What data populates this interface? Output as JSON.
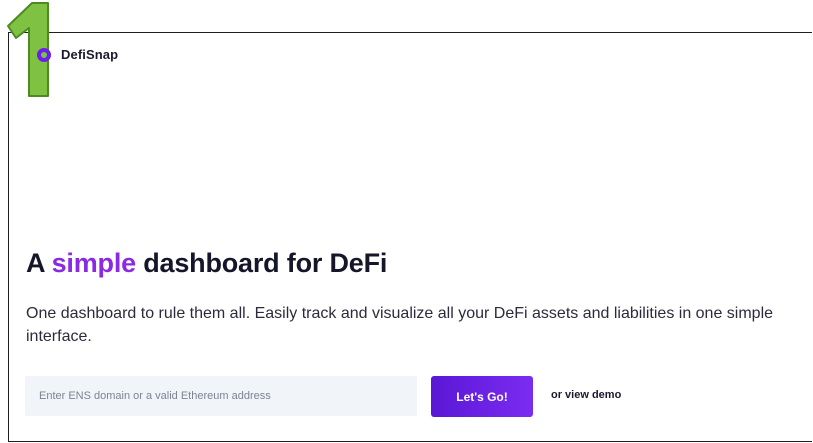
{
  "annotation": {
    "step_number": "1",
    "color": "#7fc241"
  },
  "brand": {
    "name": "DefiSnap",
    "accent_color": "#6b1ef0"
  },
  "hero": {
    "title_prefix": "A ",
    "title_highlight": "simple",
    "title_suffix": " dashboard for DeFi",
    "highlight_color": "#8a2be2",
    "description": "One dashboard to rule them all. Easily track and visualize all your DeFi assets and liabilities in one simple interface."
  },
  "search": {
    "placeholder": "Enter ENS domain or a valid Ethereum address",
    "value": ""
  },
  "actions": {
    "go_label": "Let's Go!",
    "demo_label": "or view demo"
  }
}
